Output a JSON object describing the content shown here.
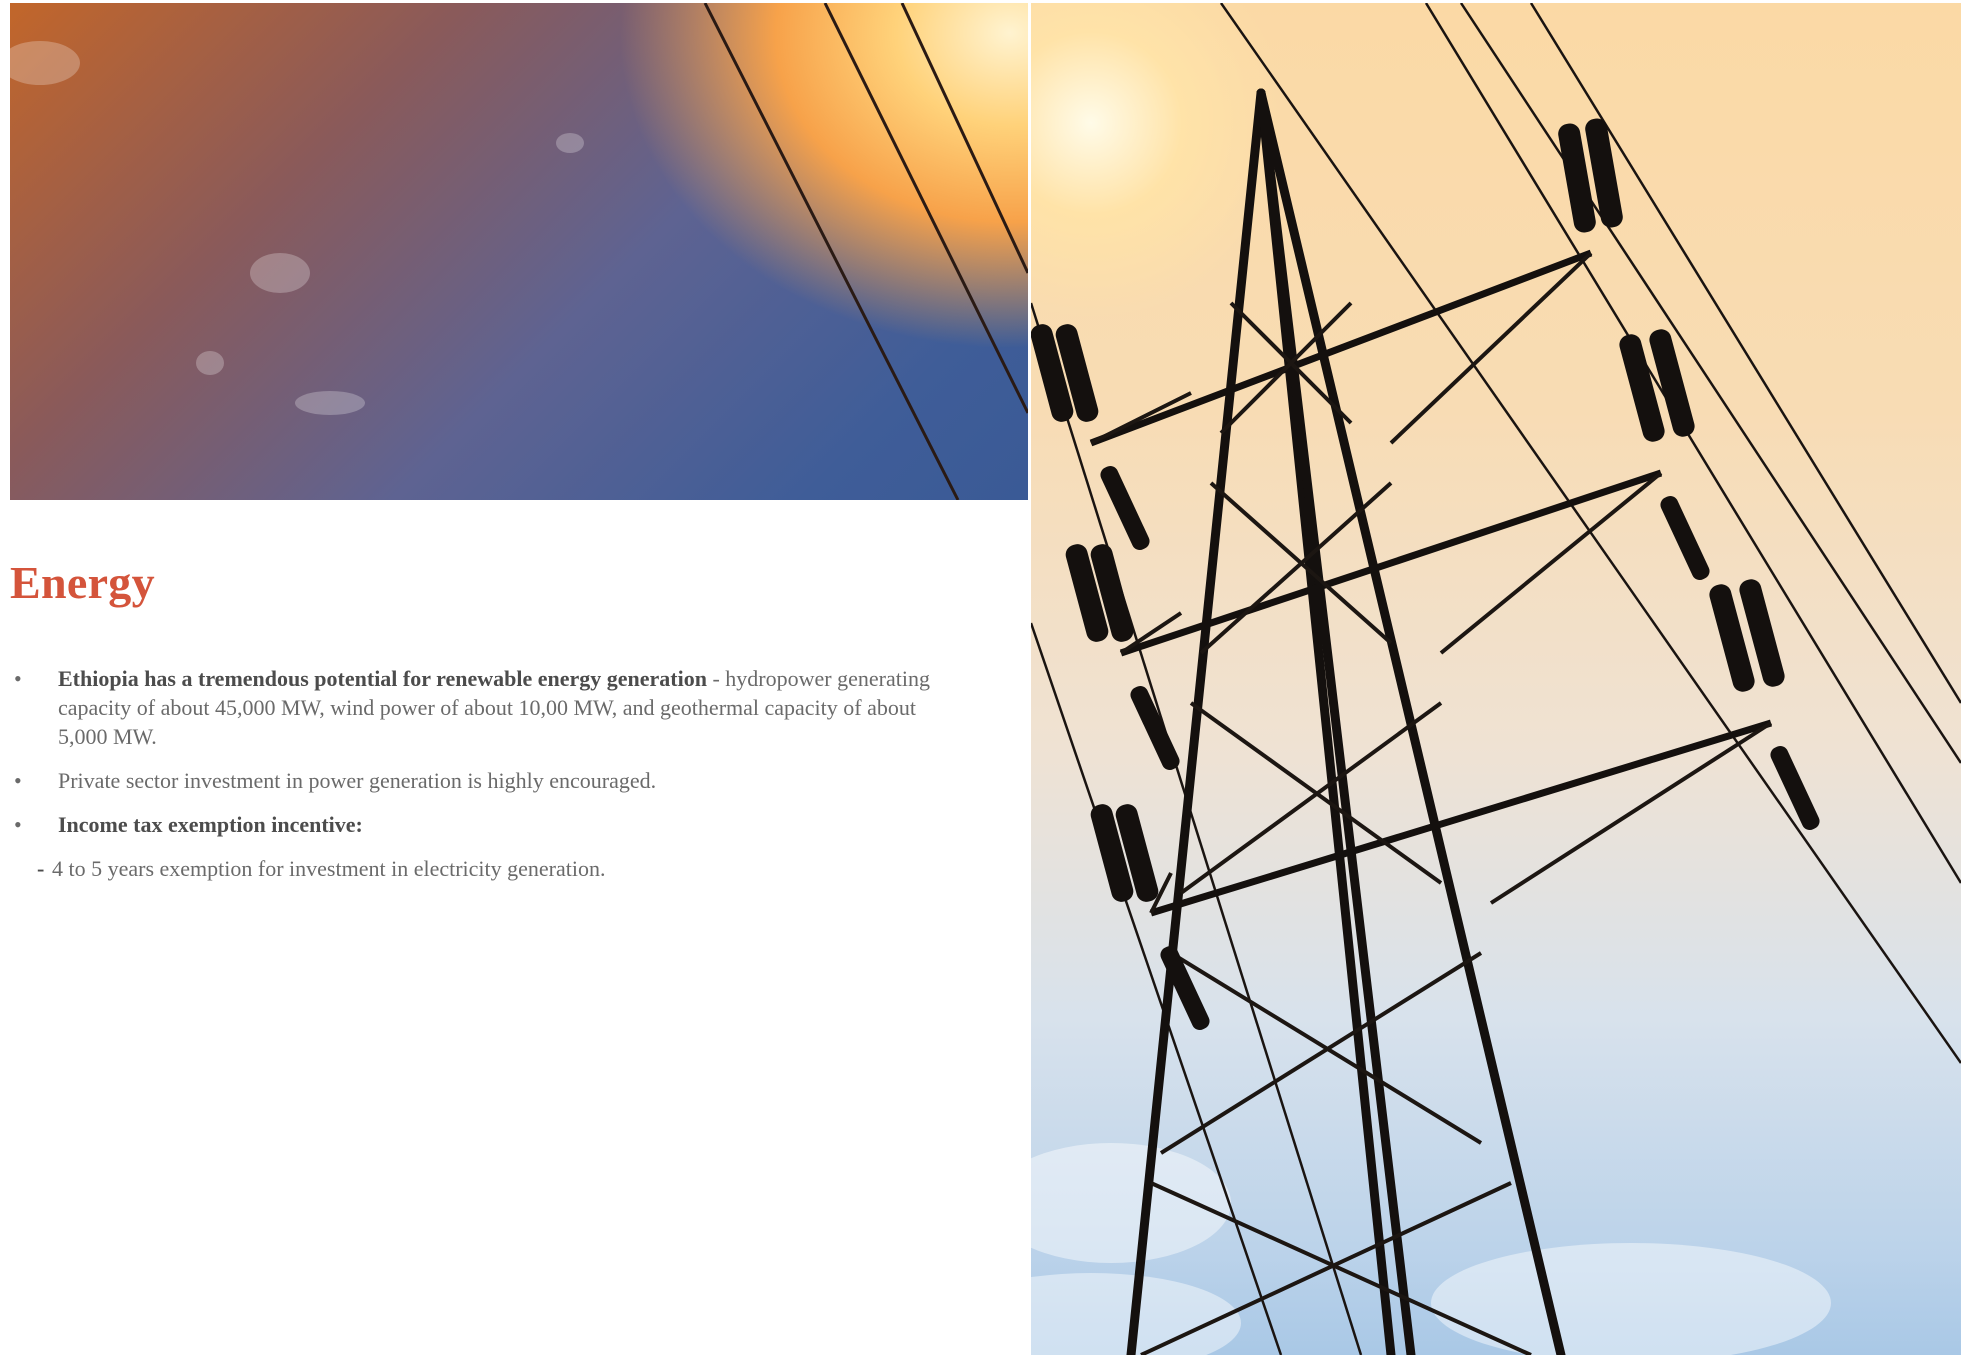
{
  "heading": "Energy",
  "bullets": [
    {
      "bold": "Ethiopia has a tremendous potential for renewable energy generation",
      "text": " - hydropower generating capacity of about 45,000 MW, wind power of about 10,00 MW, and geothermal capacity of about 5,000 MW."
    },
    {
      "bold": "",
      "text": "Private sector investment in power generation is highly encouraged."
    },
    {
      "bold": "Income tax exemption incentive:",
      "text": ""
    }
  ],
  "sub_item": {
    "dash": "-",
    "text": "4 to 5 years exemption for investment in electricity generation."
  },
  "bullet_glyph": "•",
  "colors": {
    "heading": "#d4543b",
    "body_text": "#6a6a6a",
    "bold_text": "#4c4c4c"
  },
  "images": {
    "top_left": "sunset-sky-power-lines-photo",
    "right": "electricity-pylon-photo"
  }
}
